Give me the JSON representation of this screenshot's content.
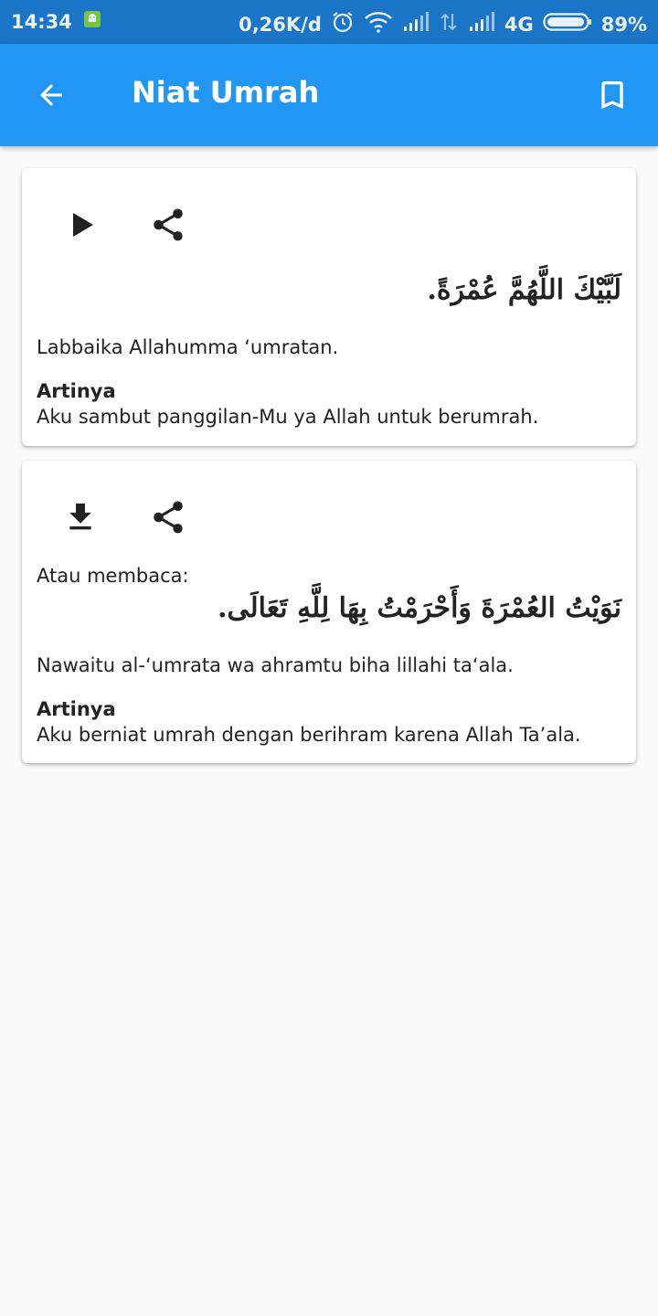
{
  "status_bar": {
    "time": "14:34",
    "speed": "0,26K/d",
    "network": "4G",
    "battery": "89%"
  },
  "app_bar": {
    "title": "Niat Umrah",
    "back_icon": "arrow-back-icon",
    "bookmark_icon": "bookmark-icon"
  },
  "cards": [
    {
      "actions": [
        "play-icon",
        "share-icon"
      ],
      "arabic": "لَبَّيْكَ اللَّهُمَّ عُمْرَةً.",
      "latin": "Labbaika Allahumma ‘umratan.",
      "meaning_label": "Artinya",
      "meaning": "Aku sambut panggilan-Mu ya Allah untuk berumrah."
    },
    {
      "actions": [
        "download-icon",
        "share-icon"
      ],
      "intro": "Atau membaca:",
      "arabic": "نَوَيْتُ العُمْرَةَ وَأَحْرَمْتُ بِهَا لِلَّهِ تَعَالَى.",
      "latin": "Nawaitu al-‘umrata wa ahramtu biha lillahi ta‘ala.",
      "meaning_label": "Artinya",
      "meaning": "Aku berniat umrah dengan berihram karena Allah Ta’ala."
    }
  ],
  "colors": {
    "app_bar": "#2196f3",
    "status_bar": "#1a75c7",
    "background": "#fafafa"
  }
}
